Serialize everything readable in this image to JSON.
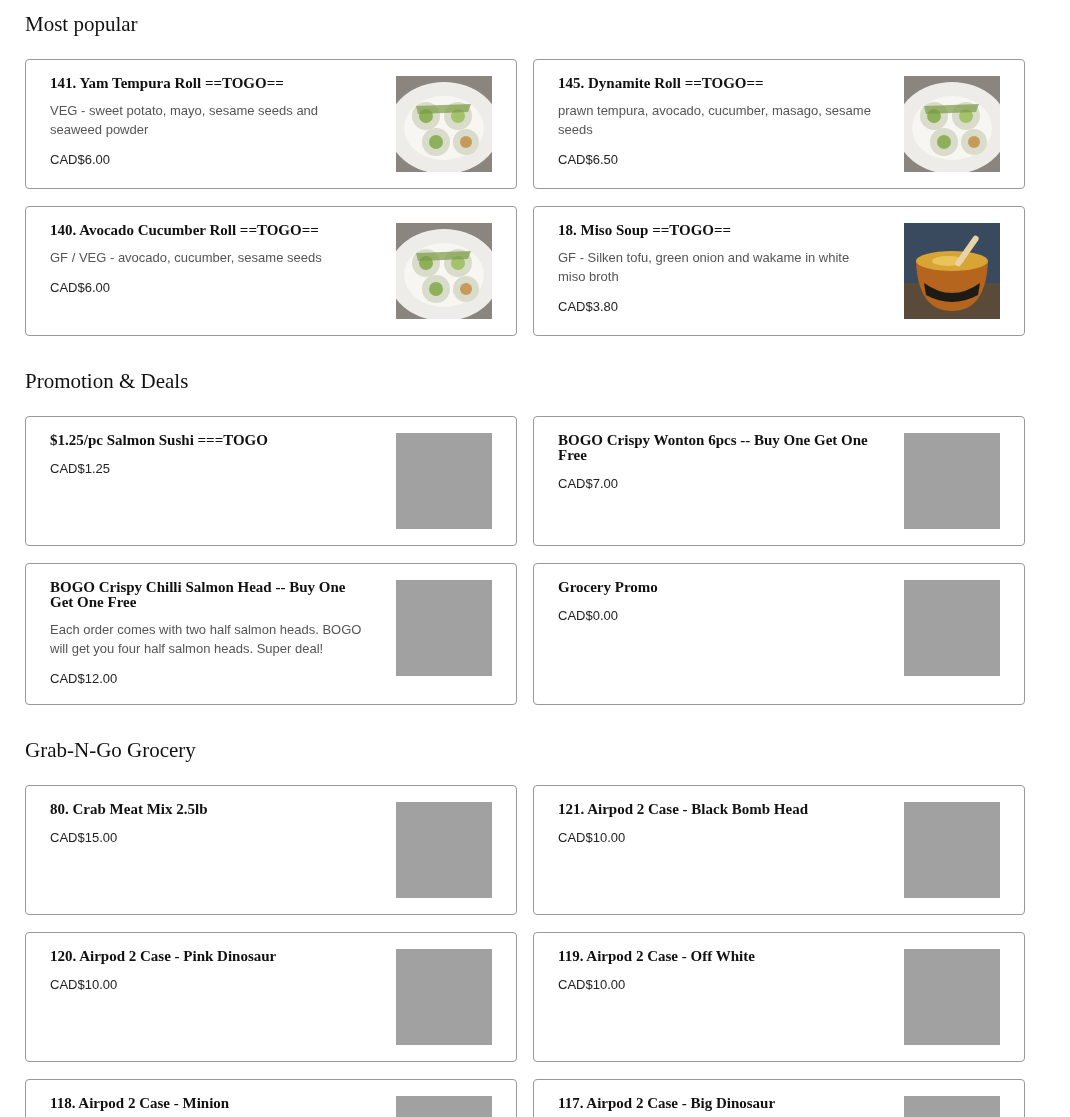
{
  "sections": [
    {
      "title": "Most popular",
      "items": [
        {
          "name": "141. Yam Tempura Roll ==TOGO==",
          "description": "VEG - sweet potato, mayo, sesame seeds and seaweed powder",
          "price": "CAD$6.00"
        },
        {
          "name": "145. Dynamite Roll ==TOGO==",
          "description": "prawn tempura, avocado, cucumber, masago, sesame seeds",
          "price": "CAD$6.50"
        },
        {
          "name": "140. Avocado Cucumber Roll ==TOGO==",
          "description": "GF / VEG - avocado, cucumber, sesame seeds",
          "price": "CAD$6.00"
        },
        {
          "name": "18. Miso Soup ==TOGO==",
          "description": "GF - Silken tofu, green onion and wakame in white miso broth",
          "price": "CAD$3.80"
        }
      ]
    },
    {
      "title": "Promotion & Deals",
      "items": [
        {
          "name": "$1.25/pc Salmon Sushi ===TOGO",
          "price": "CAD$1.25",
          "image": {
            "kind": "placeholder"
          }
        },
        {
          "name": "BOGO Crispy Wonton 6pcs -- Buy One Get One Free",
          "price": "CAD$7.00",
          "image": {
            "kind": "placeholder"
          }
        },
        {
          "name": "BOGO Crispy Chilli Salmon Head -- Buy One Get One Free",
          "description": "Each order comes with two half salmon heads. BOGO will get you four half salmon heads. Super deal!",
          "price": "CAD$12.00",
          "image": {
            "kind": "placeholder"
          }
        },
        {
          "name": "Grocery Promo",
          "price": "CAD$0.00",
          "image": {
            "kind": "placeholder"
          }
        }
      ]
    },
    {
      "title": "Grab-N-Go Grocery",
      "items": [
        {
          "name": "80. Crab Meat Mix 2.5lb",
          "price": "CAD$15.00",
          "image": {
            "kind": "placeholder"
          }
        },
        {
          "name": "121. Airpod 2 Case - Black Bomb Head",
          "price": "CAD$10.00",
          "image": {
            "kind": "placeholder"
          }
        },
        {
          "name": "120. Airpod 2 Case - Pink Dinosaur",
          "price": "CAD$10.00",
          "image": {
            "kind": "placeholder"
          }
        },
        {
          "name": "119. Airpod 2 Case - Off White",
          "price": "CAD$10.00",
          "image": {
            "kind": "placeholder"
          }
        },
        {
          "name": "118. Airpod 2 Case - Minion",
          "image": {
            "kind": "placeholder"
          }
        },
        {
          "name": "117. Airpod 2 Case - Big Dinosaur",
          "image": {
            "kind": "placeholder"
          }
        }
      ]
    }
  ]
}
